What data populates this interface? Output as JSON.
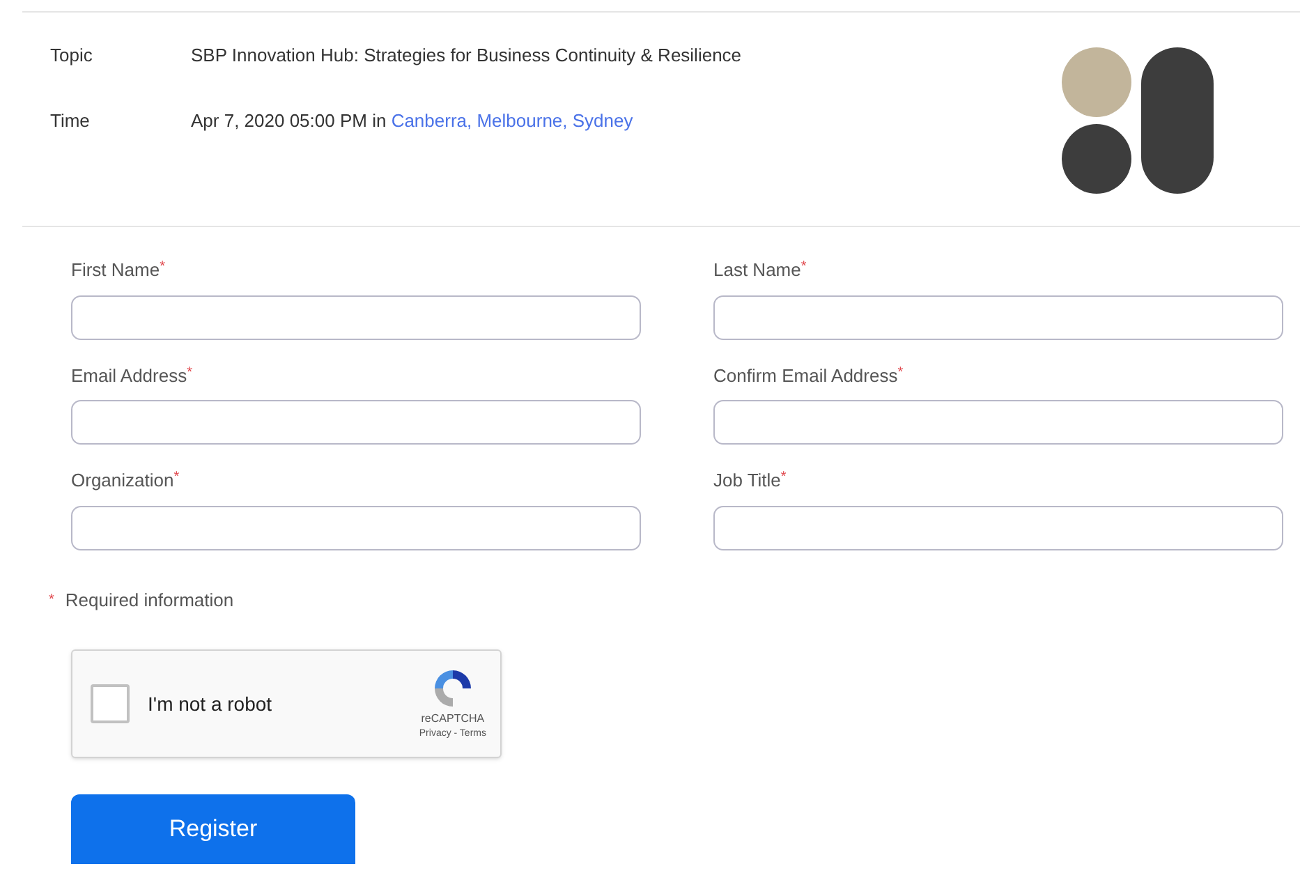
{
  "details": [
    {
      "label": "Topic",
      "value": "SBP Innovation Hub: Strategies for Business Continuity & Resilience"
    },
    {
      "label": "Time",
      "value": "Apr 7, 2020 05:00 PM in ",
      "link": "Canberra, Melbourne, Sydney"
    }
  ],
  "fields": [
    {
      "label": "First Name",
      "asterisk": "*"
    },
    {
      "label": "Last Name",
      "asterisk": "*"
    },
    {
      "label": "Email Address",
      "asterisk": "*"
    },
    {
      "label": "Confirm Email Address",
      "asterisk": "*"
    },
    {
      "label": "Organization",
      "asterisk": "*"
    },
    {
      "label": "Job Title",
      "asterisk": "*"
    }
  ],
  "required_note": {
    "asterisk": "*",
    "text": "Required information"
  },
  "captcha": {
    "label": "I'm not a robot",
    "checked": false,
    "brand": "reCAPTCHA",
    "links": "Privacy - Terms"
  },
  "register_button": "Register"
}
